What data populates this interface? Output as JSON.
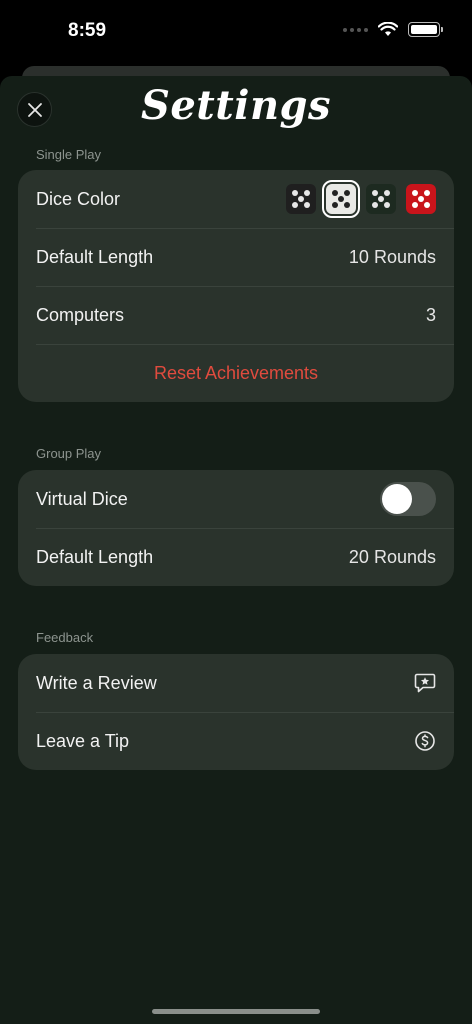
{
  "status_bar": {
    "time": "8:59"
  },
  "header": {
    "title": "Settings"
  },
  "single_play": {
    "label": "Single Play",
    "dice_color_label": "Dice Color",
    "dice_options": [
      {
        "name": "black",
        "face": "#1f1f1f",
        "pip": "#e6e6e6",
        "selected": false
      },
      {
        "name": "white",
        "face": "#e9e9e6",
        "pip": "#222222",
        "selected": true
      },
      {
        "name": "green",
        "face": "#1d2a20",
        "pip": "#e6e6e6",
        "selected": false
      },
      {
        "name": "red",
        "face": "#c9141b",
        "pip": "#ffffff",
        "selected": false
      }
    ],
    "default_length_label": "Default Length",
    "default_length_value": "10 Rounds",
    "computers_label": "Computers",
    "computers_value": "3",
    "reset_label": "Reset Achievements"
  },
  "group_play": {
    "label": "Group Play",
    "virtual_dice_label": "Virtual Dice",
    "virtual_dice_on": false,
    "default_length_label": "Default Length",
    "default_length_value": "20 Rounds"
  },
  "feedback": {
    "label": "Feedback",
    "review_label": "Write a Review",
    "tip_label": "Leave a Tip"
  },
  "colors": {
    "background": "#141e17",
    "card": "#2a332c",
    "destructive": "#e04b3e"
  }
}
